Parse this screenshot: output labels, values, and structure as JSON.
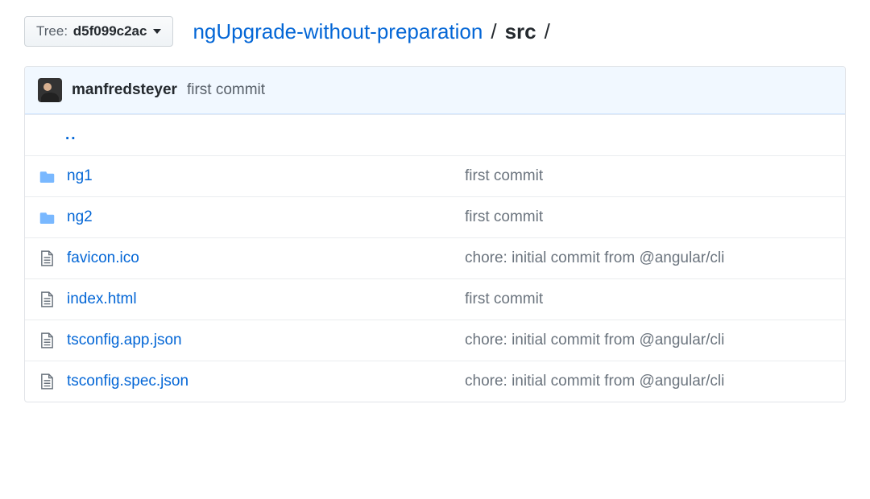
{
  "tree_button": {
    "label": "Tree:",
    "hash": "d5f099c2ac"
  },
  "breadcrumb": {
    "repo": "ngUpgrade-without-preparation",
    "dir": "src"
  },
  "commit": {
    "author": "manfredsteyer",
    "message": "first commit"
  },
  "parent_link": "..",
  "rows": [
    {
      "type": "folder",
      "name": "ng1",
      "message": "first commit"
    },
    {
      "type": "folder",
      "name": "ng2",
      "message": "first commit"
    },
    {
      "type": "file",
      "name": "favicon.ico",
      "message": "chore: initial commit from @angular/cli"
    },
    {
      "type": "file",
      "name": "index.html",
      "message": "first commit"
    },
    {
      "type": "file",
      "name": "tsconfig.app.json",
      "message": "chore: initial commit from @angular/cli"
    },
    {
      "type": "file",
      "name": "tsconfig.spec.json",
      "message": "chore: initial commit from @angular/cli"
    }
  ]
}
